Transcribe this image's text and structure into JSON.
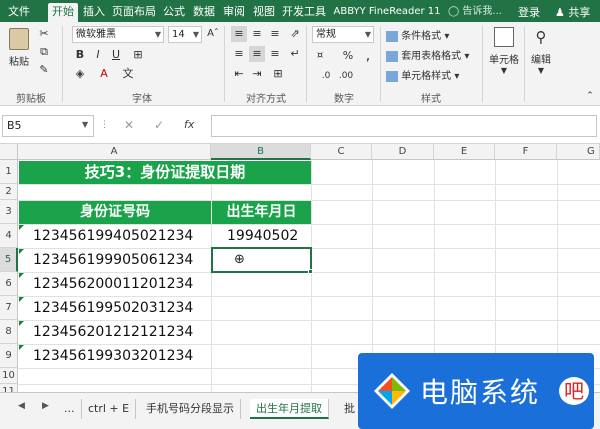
{
  "tabs": [
    "文件",
    "开始",
    "插入",
    "页面布局",
    "公式",
    "数据",
    "审阅",
    "视图",
    "开发工具",
    "ABBYY FineReader 11"
  ],
  "active_tab": "开始",
  "tell_me": "告诉我...",
  "login": "登录",
  "share": "共享",
  "ribbon": {
    "clipboard": {
      "paste": "粘贴",
      "label": "剪贴板"
    },
    "font": {
      "name": "微软雅黑",
      "size": "14",
      "label": "字体"
    },
    "alignment": {
      "label": "对齐方式"
    },
    "number": {
      "format": "常规",
      "label": "数字"
    },
    "styles": {
      "conditional": "条件格式",
      "table": "套用表格格式",
      "cell_styles": "单元格样式",
      "label": "样式"
    },
    "cells": {
      "label": "单元格"
    },
    "editing": {
      "label": "编辑"
    }
  },
  "name_box": "B5",
  "fx": "fx",
  "columns": [
    "A",
    "B",
    "C",
    "D",
    "E",
    "F",
    "G"
  ],
  "rows": [
    "1",
    "2",
    "3",
    "4",
    "5",
    "6",
    "7",
    "8",
    "9",
    "10",
    "11"
  ],
  "sheet": {
    "title": "技巧3：身份证提取日期",
    "header_a": "身份证号码",
    "header_b": "出生年月日",
    "ids": [
      "123456199405021234",
      "123456199905061234",
      "123456200011201234",
      "123456199502031234",
      "123456201212121234",
      "123456199303201234"
    ],
    "b4": "19940502",
    "cursor": "⊕"
  },
  "sheet_tabs": [
    "...",
    "ctrl + E",
    "手机号码分段显示",
    "出生年月提取",
    "批"
  ],
  "active_sheet": "出生年月提取",
  "watermark": "电脑系统",
  "watermark_last": "吧",
  "colors": {
    "accent": "#217346",
    "header_fill": "#1aa34a",
    "watermark": "#1b6fd9"
  }
}
